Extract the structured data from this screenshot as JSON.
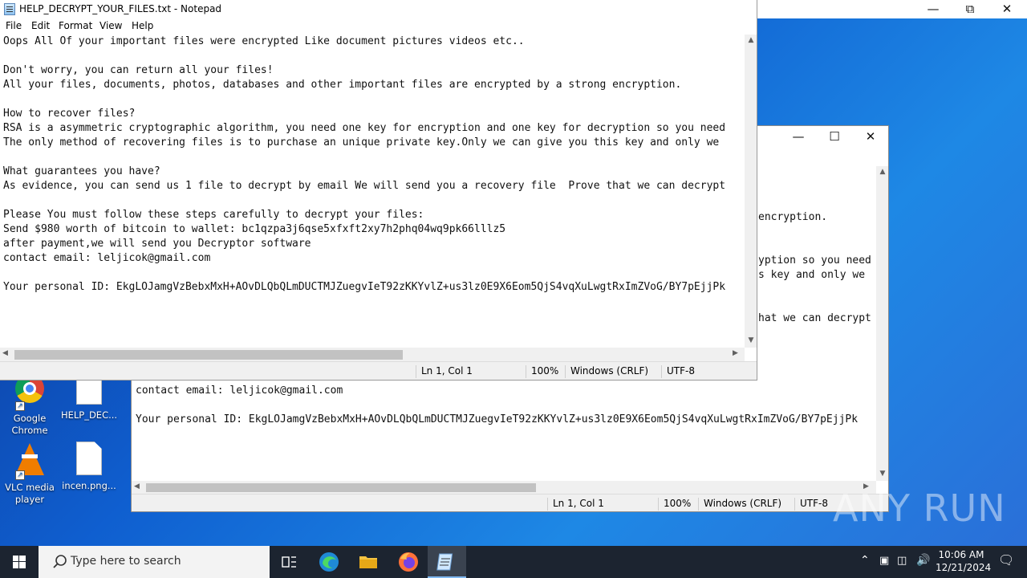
{
  "notepad_front": {
    "title": "HELP_DECRYPT_YOUR_FILES.txt - Notepad",
    "menu": [
      "File",
      "Edit",
      "Format",
      "View",
      "Help"
    ],
    "lines": [
      "Oops All Of your important files were encrypted Like document pictures videos etc..",
      "",
      "Don't worry, you can return all your files!",
      "All your files, documents, photos, databases and other important files are encrypted by a strong encryption.",
      "",
      "How to recover files?",
      "RSA is a asymmetric cryptographic algorithm, you need one key for encryption and one key for decryption so you need",
      "The only method of recovering files is to purchase an unique private key.Only we can give you this key and only we",
      "",
      "What guarantees you have?",
      "As evidence, you can send us 1 file to decrypt by email We will send you a recovery file  Prove that we can decrypt",
      "",
      "Please You must follow these steps carefully to decrypt your files:",
      "Send $980 worth of bitcoin to wallet: bc1qzpa3j6qse5xfxft2xy7h2phq04wq9pk66lllz5",
      "after payment,we will send you Decryptor software",
      "contact email: leljicok@gmail.com",
      "",
      "Your personal ID: EkgLOJamgVzBebxMxH+AOvDLQbQLmDUCTMJZuegvIeT92zKKYvlZ+us3lz0E9X6Eom5QjS4vqXuLwgtRxImZVoG/BY7pEjjPk"
    ],
    "status": {
      "position": "Ln 1, Col 1",
      "zoom": "100%",
      "eol": "Windows (CRLF)",
      "encoding": "UTF-8"
    }
  },
  "notepad_back": {
    "visible_right_fragments": [
      "encryption.",
      "yption so you need",
      "s key and only we",
      "hat we can decrypt"
    ],
    "visible_lines": [
      "contact email: leljicok@gmail.com",
      "",
      "Your personal ID: EkgLOJamgVzBebxMxH+AOvDLQbQLmDUCTMJZuegvIeT92zKKYvlZ+us3lz0E9X6Eom5QjS4vqXuLwgtRxImZVoG/BY7pEjjPk"
    ],
    "status": {
      "position": "Ln 1, Col 1",
      "zoom": "100%",
      "eol": "Windows (CRLF)",
      "encoding": "UTF-8"
    }
  },
  "desktop_icons": [
    {
      "label": "Google Chrome",
      "icon": "chrome-icon"
    },
    {
      "label": "HELP_DEC...",
      "icon": "text-file-icon"
    },
    {
      "label": "VLC media player",
      "icon": "vlc-icon"
    },
    {
      "label": "incen.png...",
      "icon": "file-icon"
    }
  ],
  "taskbar": {
    "search_placeholder": "Type here to search",
    "time": "10:06 AM",
    "date": "12/21/2024"
  },
  "watermark": "ANY RUN"
}
